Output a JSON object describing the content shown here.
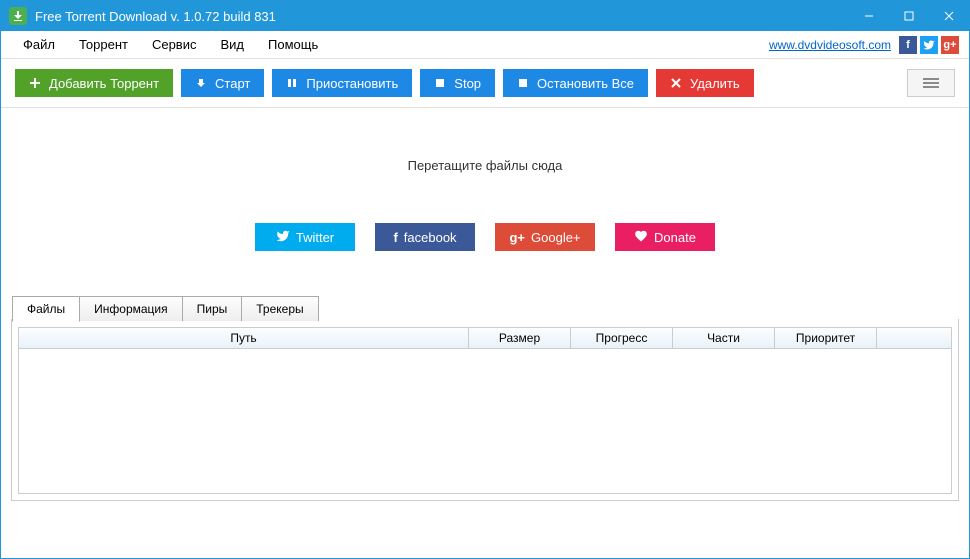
{
  "titlebar": {
    "title": "Free Torrent Download v. 1.0.72 build 831"
  },
  "menubar": {
    "items": [
      "Файл",
      "Торрент",
      "Сервис",
      "Вид",
      "Помощь"
    ],
    "link": "www.dvdvideosoft.com"
  },
  "toolbar": {
    "add": "Добавить Торрент",
    "start": "Старт",
    "pause": "Приостановить",
    "stop": "Stop",
    "stopAll": "Остановить Все",
    "delete": "Удалить"
  },
  "dropzone": {
    "text": "Перетащите файлы сюда",
    "twitter": "Twitter",
    "facebook": "facebook",
    "google": "Google+",
    "donate": "Donate"
  },
  "tabs": {
    "files": "Файлы",
    "info": "Информация",
    "peers": "Пиры",
    "trackers": "Трекеры"
  },
  "columns": {
    "path": "Путь",
    "size": "Размер",
    "progress": "Прогресс",
    "parts": "Части",
    "priority": "Приоритет"
  }
}
